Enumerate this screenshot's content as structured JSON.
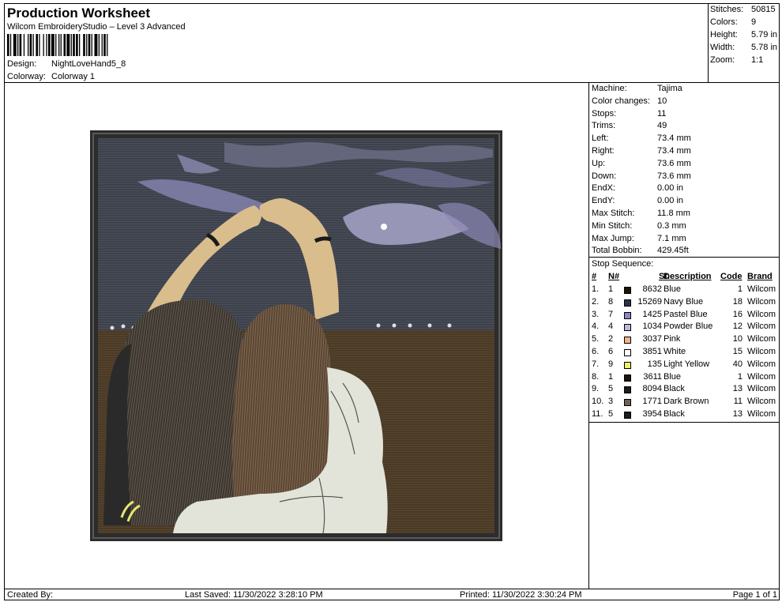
{
  "header": {
    "title": "Production Worksheet",
    "software": "Wilcom EmbroideryStudio – Level 3 Advanced",
    "design_label": "Design:",
    "design_value": "NightLoveHand5_8",
    "colorway_label": "Colorway:",
    "colorway_value": "Colorway 1"
  },
  "summary": [
    {
      "label": "Stitches:",
      "value": "50815"
    },
    {
      "label": "Colors:",
      "value": "9"
    },
    {
      "label": "Height:",
      "value": "5.79 in"
    },
    {
      "label": "Width:",
      "value": "5.78 in"
    },
    {
      "label": "Zoom:",
      "value": "1:1"
    }
  ],
  "machine_info": [
    {
      "label": "Machine:",
      "value": "Tajima"
    },
    {
      "label": "Color changes:",
      "value": "10"
    },
    {
      "label": "Stops:",
      "value": "11"
    },
    {
      "label": "Trims:",
      "value": "49"
    },
    {
      "label": "Left:",
      "value": "73.4 mm"
    },
    {
      "label": "Right:",
      "value": "73.4 mm"
    },
    {
      "label": "Up:",
      "value": "73.6 mm"
    },
    {
      "label": "Down:",
      "value": "73.6 mm"
    },
    {
      "label": "EndX:",
      "value": "0.00 in"
    },
    {
      "label": "EndY:",
      "value": "0.00 in"
    },
    {
      "label": "Max Stitch:",
      "value": "11.8 mm"
    },
    {
      "label": "Min Stitch:",
      "value": "0.3 mm"
    },
    {
      "label": "Max Jump:",
      "value": "7.1 mm"
    },
    {
      "label": "Total Bobbin:",
      "value": "429.45ft"
    }
  ],
  "stop_sequence": {
    "title": "Stop Sequence:",
    "headers": {
      "num": "#",
      "n": "N#",
      "st": "St.",
      "desc": "Description",
      "code": "Code",
      "brand": "Brand"
    },
    "rows": [
      {
        "num": "1.",
        "n": "1",
        "color": "#1f1208",
        "st": "8632",
        "desc": "Blue",
        "code": "1",
        "brand": "Wilcom"
      },
      {
        "num": "2.",
        "n": "8",
        "color": "#2a3346",
        "st": "15269",
        "desc": "Navy Blue",
        "code": "18",
        "brand": "Wilcom"
      },
      {
        "num": "3.",
        "n": "7",
        "color": "#8d86c4",
        "st": "1425",
        "desc": "Pastel Blue",
        "code": "16",
        "brand": "Wilcom"
      },
      {
        "num": "4.",
        "n": "4",
        "color": "#c1b6dc",
        "st": "1034",
        "desc": "Powder Blue",
        "code": "12",
        "brand": "Wilcom"
      },
      {
        "num": "5.",
        "n": "2",
        "color": "#efb58c",
        "st": "3037",
        "desc": "Pink",
        "code": "10",
        "brand": "Wilcom"
      },
      {
        "num": "6.",
        "n": "6",
        "color": "#ffffff",
        "st": "3851",
        "desc": "White",
        "code": "15",
        "brand": "Wilcom"
      },
      {
        "num": "7.",
        "n": "9",
        "color": "#f2f26a",
        "st": "135",
        "desc": "Light Yellow",
        "code": "40",
        "brand": "Wilcom"
      },
      {
        "num": "8.",
        "n": "1",
        "color": "#1f1208",
        "st": "3611",
        "desc": "Blue",
        "code": "1",
        "brand": "Wilcom"
      },
      {
        "num": "9.",
        "n": "5",
        "color": "#1c1c1c",
        "st": "8094",
        "desc": "Black",
        "code": "13",
        "brand": "Wilcom"
      },
      {
        "num": "10.",
        "n": "3",
        "color": "#6f6058",
        "st": "1771",
        "desc": "Dark Brown",
        "code": "11",
        "brand": "Wilcom"
      },
      {
        "num": "11.",
        "n": "5",
        "color": "#1c1c1c",
        "st": "3954",
        "desc": "Black",
        "code": "13",
        "brand": "Wilcom"
      }
    ]
  },
  "footer": {
    "created_by": "Created By:",
    "last_saved": "Last Saved: 11/30/2022 3:28:10 PM",
    "printed": "Printed: 11/30/2022 3:30:24 PM",
    "page": "Page 1 of 1"
  }
}
